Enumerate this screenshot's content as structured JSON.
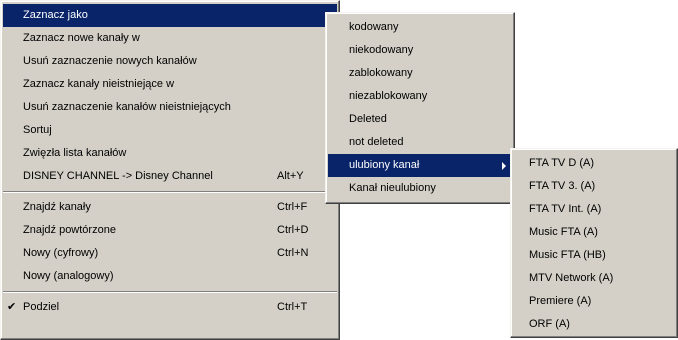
{
  "main_menu": {
    "items": [
      {
        "label": "Zaznacz jako",
        "shortcut": "",
        "submenu": true
      },
      {
        "label": "Zaznacz nowe kanały w",
        "shortcut": "",
        "submenu": true
      },
      {
        "label": "Usuń zaznaczenie nowych kanałów",
        "shortcut": "",
        "submenu": false
      },
      {
        "label": "Zaznacz kanały nieistniejące w",
        "shortcut": "",
        "submenu": true
      },
      {
        "label": "Usuń zaznaczenie kanałów nieistniejących",
        "shortcut": "",
        "submenu": false
      },
      {
        "label": "Sortuj",
        "shortcut": "",
        "submenu": true
      },
      {
        "label": "Zwięzła lista kanałów",
        "shortcut": "",
        "submenu": false
      },
      {
        "label": "DISNEY CHANNEL -> Disney Channel",
        "shortcut": "Alt+Y",
        "submenu": false
      },
      {
        "label": "Znajdź kanały",
        "shortcut": "Ctrl+F",
        "submenu": false
      },
      {
        "label": "Znajdź powtórzone",
        "shortcut": "Ctrl+D",
        "submenu": false
      },
      {
        "label": "Nowy (cyfrowy)",
        "shortcut": "Ctrl+N",
        "submenu": false
      },
      {
        "label": "Nowy (analogowy)",
        "shortcut": "",
        "submenu": false
      },
      {
        "label": "Podziel",
        "shortcut": "Ctrl+T",
        "submenu": false,
        "checked": true
      }
    ],
    "check_mark": "✔"
  },
  "mark_as_submenu": {
    "items": [
      "kodowany",
      "niekodowany",
      "zablokowany",
      "niezablokowany",
      "Deleted",
      "not deleted",
      "ulubiony kanał",
      "Kanał nieulubiony"
    ]
  },
  "favorites_submenu": {
    "items": [
      "FTA TV D (A)",
      "FTA TV 3. (A)",
      "FTA TV Int. (A)",
      "Music FTA (A)",
      "Music FTA (HB)",
      "MTV Network (A)",
      "Premiere (A)",
      "ORF (A)"
    ]
  },
  "colors": {
    "menu_bg": "#d4d0c8",
    "highlight": "#0a246a",
    "highlight_text": "#ffffff"
  }
}
